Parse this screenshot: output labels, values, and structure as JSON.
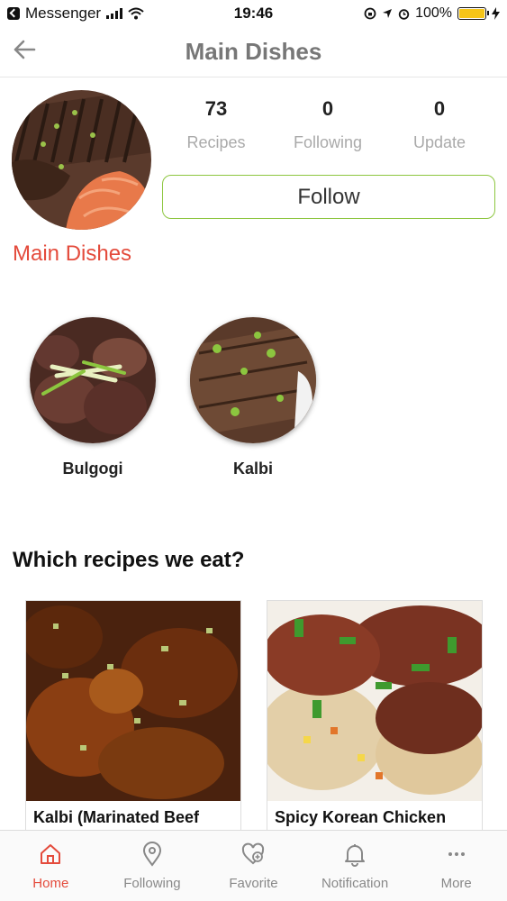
{
  "status_bar": {
    "app_back": "Messenger",
    "time": "19:46",
    "battery": "100%"
  },
  "nav": {
    "title": "Main Dishes"
  },
  "profile": {
    "stats": [
      {
        "value": "73",
        "label": "Recipes"
      },
      {
        "value": "0",
        "label": "Following"
      },
      {
        "value": "0",
        "label": "Update"
      }
    ],
    "follow_label": "Follow",
    "section_title": "Main Dishes"
  },
  "categories": [
    {
      "label": "Bulgogi"
    },
    {
      "label": "Kalbi"
    }
  ],
  "recipes": {
    "heading": "Which recipes we eat?",
    "items": [
      {
        "title": "Kalbi (Marinated Beef"
      },
      {
        "title": "Spicy Korean Chicken"
      }
    ]
  },
  "tabbar": {
    "items": [
      {
        "label": "Home",
        "icon": "home-icon"
      },
      {
        "label": "Following",
        "icon": "location-pin-icon"
      },
      {
        "label": "Favorite",
        "icon": "heart-plus-icon"
      },
      {
        "label": "Notification",
        "icon": "bell-icon"
      },
      {
        "label": "More",
        "icon": "more-dots-icon"
      }
    ],
    "active_color": "#e44b3c"
  },
  "colors": {
    "accent": "#e44b3c",
    "follow_border": "#8dc63f"
  }
}
